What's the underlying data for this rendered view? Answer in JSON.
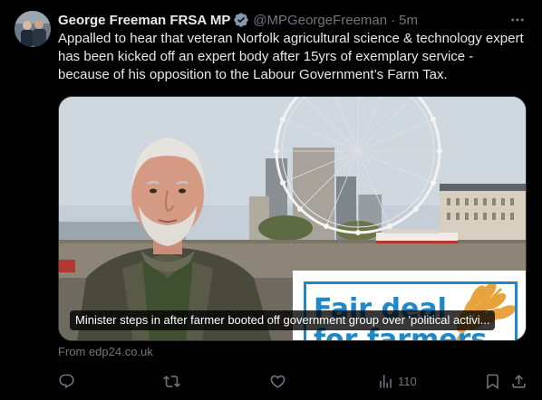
{
  "author": {
    "display_name": "George Freeman FRSA MP",
    "handle": "@MPGeorgeFreeman",
    "separator": "·",
    "time": "5m",
    "verified": true,
    "avatar_icon": "profile-photo"
  },
  "tweet": {
    "text": "Appalled to hear that veteran Norfolk agricultural science & technology expert has been kicked off an expert body after 15yrs of exemplary service - because of his opposition to the Labour Government’s Farm Tax."
  },
  "card": {
    "caption": "Minister steps in after farmer booted off government group over 'political activi...",
    "logo_line1": "Fair deal",
    "logo_line2": "for farmers",
    "source": "From edp24.co.uk"
  },
  "actions": {
    "reply_icon": "reply-icon",
    "retweet_icon": "retweet-icon",
    "like_icon": "heart-icon",
    "views_icon": "views-icon",
    "views_count": "110",
    "bookmark_icon": "bookmark-icon",
    "share_icon": "share-icon"
  },
  "colors": {
    "background": "#000000",
    "text_primary": "#e7e9ea",
    "text_secondary": "#71767b",
    "verified_badge": "#829aab",
    "logo_blue": "#1e88c9",
    "logo_gold": "#e8a33d"
  }
}
